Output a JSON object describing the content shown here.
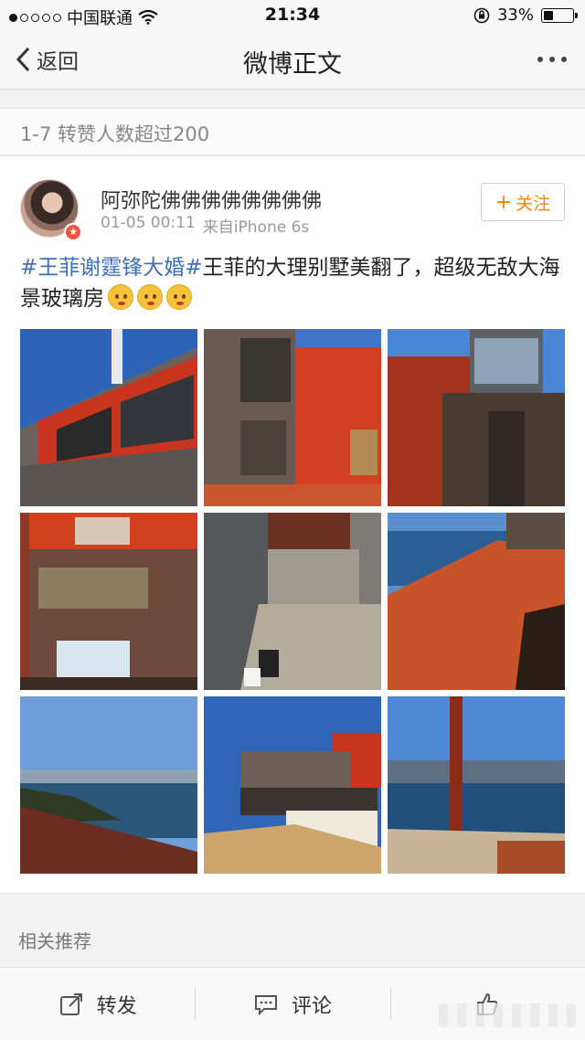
{
  "status_bar": {
    "carrier": "中国联通",
    "time": "21:34",
    "battery_text": "33%",
    "battery_level": 0.33,
    "icons": [
      "signal-dots-icon",
      "wifi-icon",
      "orientation-lock-icon",
      "battery-icon"
    ]
  },
  "nav": {
    "back_label": "返回",
    "title": "微博正文"
  },
  "repost_header": "1-7 转赞人数超过200",
  "post": {
    "username": "阿弥陀佛佛佛佛佛佛佛佛",
    "time": "01-05 00:11",
    "source": "来自iPhone 6s",
    "follow_label": "关注",
    "hashtag": "#王菲谢霆锋大婚#",
    "body": "王菲的大理别墅美翻了，超级无敌大海景玻璃房",
    "emoji_count": 3,
    "photos": [
      {
        "name": "villa-red-facade"
      },
      {
        "name": "villa-red-walls"
      },
      {
        "name": "villa-glass-frame"
      },
      {
        "name": "villa-front-entrance"
      },
      {
        "name": "villa-stone-stairs"
      },
      {
        "name": "villa-red-soil-terrace"
      },
      {
        "name": "lake-view-hillside"
      },
      {
        "name": "villa-under-construction"
      },
      {
        "name": "lake-view-beam"
      }
    ]
  },
  "related_label": "相关推荐",
  "actions": {
    "repost_label": "转发",
    "comment_label": "评论"
  },
  "colors": {
    "accent_orange": "#ff8200",
    "hashtag_blue": "#3f6fb5"
  }
}
